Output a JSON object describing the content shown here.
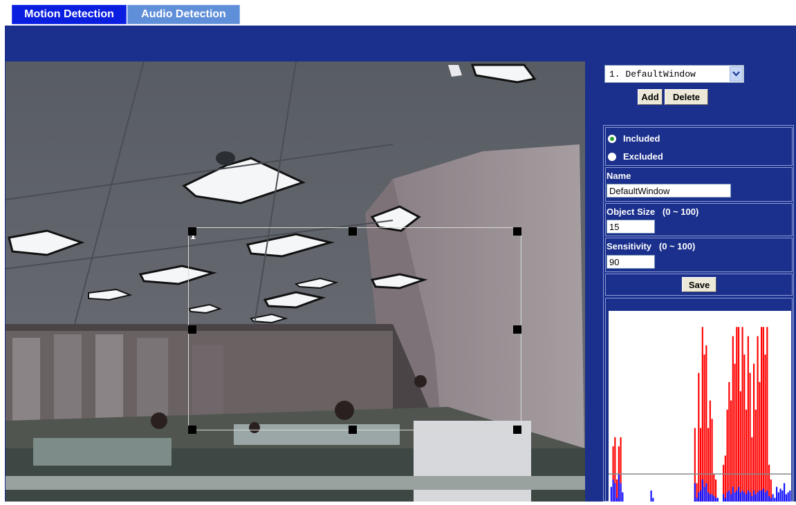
{
  "tabs": [
    {
      "label": "Motion Detection",
      "active": true
    },
    {
      "label": "Audio Detection",
      "active": false
    }
  ],
  "video": {
    "window_label": "1"
  },
  "window_selector": {
    "selected": "1. DefaultWindow"
  },
  "buttons": {
    "add": "Add",
    "delete": "Delete",
    "save": "Save"
  },
  "mode": {
    "included_label": "Included",
    "excluded_label": "Excluded",
    "selected": "Included"
  },
  "name_field": {
    "label": "Name",
    "value": "DefaultWindow"
  },
  "object_size": {
    "label": "Object Size",
    "range": "(0 ~ 100)",
    "value": "15"
  },
  "sensitivity": {
    "label": "Sensitivity",
    "range": "(0 ~ 100)",
    "value": "90"
  },
  "colors": {
    "panel_bg": "#1b2f8c",
    "tab_active": "#0a1ee0",
    "tab_inactive": "#5f8fd8",
    "motion_bar": "#ff0000",
    "level_bar": "#1010ff",
    "threshold_line": "#888888"
  },
  "activity_graph": {
    "threshold_level": 0.15,
    "red_levels": [
      0,
      0,
      0.3,
      0.35,
      0.12,
      0.3,
      0.35,
      0,
      0,
      0,
      0,
      0,
      0,
      0,
      0,
      0,
      0,
      0,
      0,
      0,
      0,
      0,
      0,
      0,
      0,
      0,
      0,
      0,
      0,
      0,
      0,
      0,
      0,
      0,
      0,
      0,
      0,
      0,
      0,
      0,
      0,
      0,
      0,
      0,
      0,
      0.4,
      0.1,
      0.7,
      0.4,
      0.95,
      0.8,
      0.85,
      0.4,
      0.55,
      0.45,
      0.15,
      0.12,
      0,
      0,
      0,
      0.2,
      0.25,
      0.5,
      0.65,
      0.55,
      0.9,
      0.75,
      0.95,
      0.95,
      0.6,
      0.95,
      0.8,
      0.5,
      0.9,
      0.7,
      0.35,
      0.75,
      0.5,
      0.9,
      0.65,
      0.95,
      0.95,
      0.8,
      0.95,
      0.2,
      0.12,
      0,
      0,
      0,
      0,
      0,
      0,
      0,
      0,
      0,
      0
    ],
    "blue_levels": [
      0,
      0.08,
      0.12,
      0.1,
      0.02,
      0.15,
      0.1,
      0.05,
      0,
      0,
      0,
      0,
      0,
      0,
      0,
      0,
      0,
      0,
      0,
      0,
      0,
      0,
      0.06,
      0.02,
      0,
      0,
      0,
      0,
      0,
      0,
      0,
      0,
      0,
      0,
      0,
      0,
      0,
      0,
      0,
      0,
      0,
      0,
      0,
      0,
      0,
      0.1,
      0.02,
      0.05,
      0.06,
      0.12,
      0.08,
      0.1,
      0.05,
      0.04,
      0.04,
      0.03,
      0.02,
      0.02,
      0,
      0,
      0.04,
      0.02,
      0.05,
      0.06,
      0.04,
      0.08,
      0.05,
      0.06,
      0.08,
      0.05,
      0.06,
      0.05,
      0.04,
      0.06,
      0.05,
      0.03,
      0.06,
      0.04,
      0.05,
      0.06,
      0.06,
      0.07,
      0.05,
      0.06,
      0.03,
      0.02,
      0.04,
      0.02,
      0.08,
      0.05,
      0.07,
      0.06,
      0.1,
      0.04,
      0.05,
      0.06
    ]
  }
}
